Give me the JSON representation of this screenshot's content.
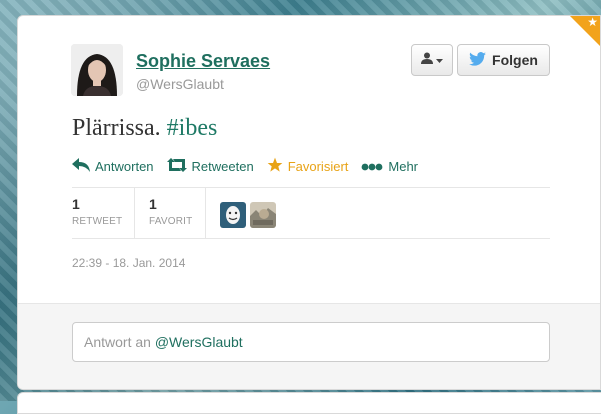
{
  "user": {
    "name": "Sophie Servaes",
    "handle": "@WersGlaubt"
  },
  "buttons": {
    "follow_label": "Folgen"
  },
  "tweet": {
    "text_plain": "Plärrissa.",
    "hashtag": "#ibes",
    "timestamp": "22:39 - 18. Jan. 2014"
  },
  "actions": {
    "reply": "Antworten",
    "retweet": "Retweeten",
    "favorite": "Favorisiert",
    "more": "Mehr"
  },
  "stats": {
    "retweets_count": "1",
    "retweets_label": "RETWEET",
    "favorites_count": "1",
    "favorites_label": "FAVORIT"
  },
  "reply": {
    "prefix": "Antwort an",
    "mention": "@WersGlaubt"
  },
  "colors": {
    "accent": "#1f6f5f",
    "favorite": "#e8a317",
    "twitter_blue": "#55acee"
  },
  "icons": [
    "person-icon",
    "twitter-bird-icon",
    "reply-icon",
    "retweet-icon",
    "star-icon",
    "more-icon"
  ]
}
